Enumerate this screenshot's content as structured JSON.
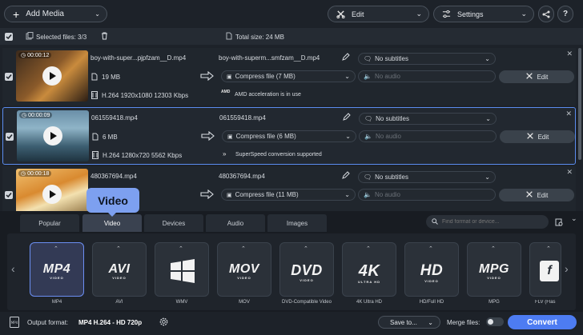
{
  "toolbar": {
    "add_media": "Add Media",
    "edit": "Edit",
    "settings": "Settings"
  },
  "selection": {
    "selected_files": "Selected files: 3/3",
    "total_size": "Total size: 24 MB"
  },
  "files": [
    {
      "duration": "00:00:12",
      "name": "boy-with-super...pjpfzam__D.mp4",
      "out_name": "boy-with-superm...smfzam__D.mp4",
      "size": "19 MB",
      "codec": "H.264 1920x1080 12303 Kbps",
      "compress": "Compress file (7 MB)",
      "subtitles": "No subtitles",
      "audio": "No audio",
      "edit": "Edit",
      "note": "AMD acceleration is in use",
      "note_badge": "AMD"
    },
    {
      "duration": "00:00:09",
      "name": "061559418.mp4",
      "out_name": "061559418.mp4",
      "size": "6 MB",
      "codec": "H.264 1280x720 5562 Kbps",
      "compress": "Compress file (6 MB)",
      "subtitles": "No subtitles",
      "audio": "No audio",
      "edit": "Edit",
      "note": "SuperSpeed conversion supported"
    },
    {
      "duration": "00:00:18",
      "name": "480367694.mp4",
      "out_name": "480367694.mp4",
      "compress": "Compress file (11 MB)",
      "subtitles": "No subtitles",
      "audio": "No audio",
      "edit": "Edit"
    }
  ],
  "tooltip": "Video",
  "tabs": [
    "Popular",
    "Video",
    "Devices",
    "Audio",
    "Images"
  ],
  "search": {
    "placeholder": "Find format or device..."
  },
  "formats": [
    {
      "logo": "MP4",
      "sub": "VIDEO",
      "label": "MP4"
    },
    {
      "logo": "AVI",
      "sub": "VIDEO",
      "label": "AVI"
    },
    {
      "logo": "",
      "sub": "",
      "label": "WMV"
    },
    {
      "logo": "MOV",
      "sub": "VIDEO",
      "label": "MOV"
    },
    {
      "logo": "DVD",
      "sub": "VIDEO",
      "label": "DVD-Compatible Video"
    },
    {
      "logo": "4K",
      "sub": "ULTRA HD",
      "label": "4K Ultra HD"
    },
    {
      "logo": "HD",
      "sub": "VIDEO",
      "label": "HD/Full HD"
    },
    {
      "logo": "MPG",
      "sub": "VIDEO",
      "label": "MPG"
    },
    {
      "logo": "",
      "sub": "",
      "label": "FLV (Flas"
    }
  ],
  "bottom": {
    "output_label": "Output format:",
    "output_value": "MP4 H.264 - HD 720p",
    "save_to": "Save to...",
    "merge_files": "Merge files:",
    "convert": "Convert"
  },
  "colors": {
    "accent": "#4d7cf2",
    "background": "#1d2229"
  }
}
